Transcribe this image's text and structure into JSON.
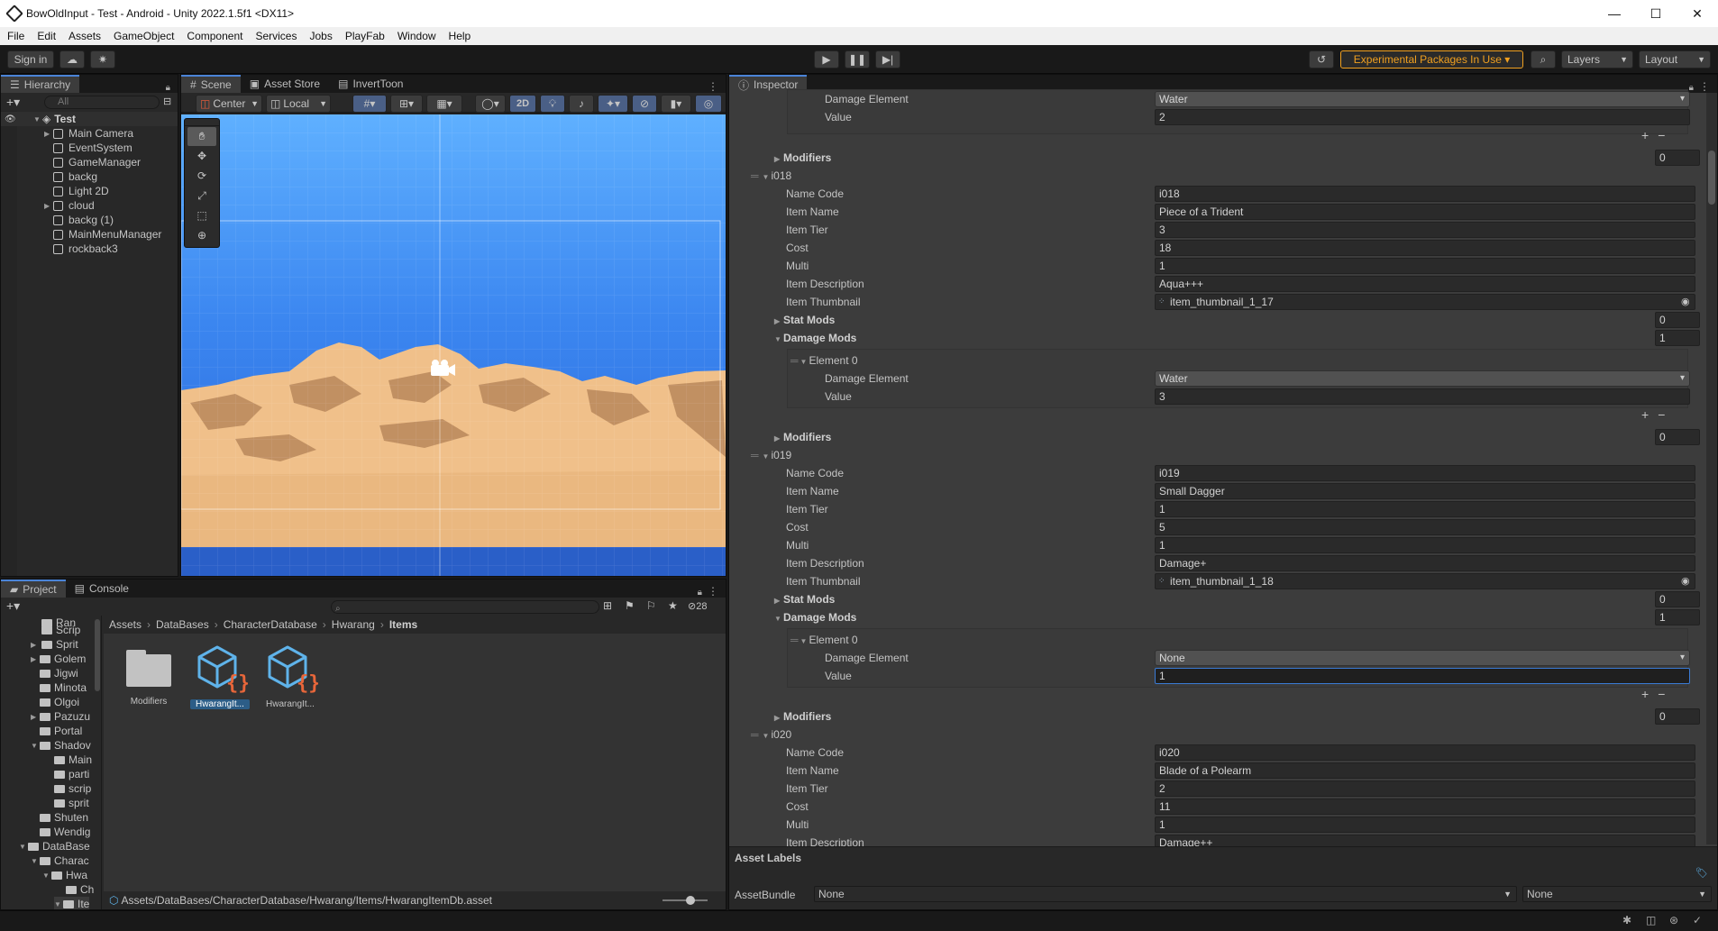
{
  "window": {
    "title": "BowOldInput - Test - Android - Unity 2022.1.5f1 <DX11>",
    "minimize": "—",
    "maximize": "☐",
    "close": "✕"
  },
  "menu": [
    "File",
    "Edit",
    "Assets",
    "GameObject",
    "Component",
    "Services",
    "Jobs",
    "PlayFab",
    "Window",
    "Help"
  ],
  "toolbar": {
    "sign_in": "Sign in",
    "experimental": "Experimental Packages In Use ▾",
    "layers": "Layers",
    "layout": "Layout"
  },
  "hierarchy": {
    "tab": "Hierarchy",
    "search_placeholder": "All",
    "scene": "Test",
    "items": [
      "Main Camera",
      "EventSystem",
      "GameManager",
      "backg",
      "Light 2D",
      "cloud",
      "backg (1)",
      "MainMenuManager",
      "rockback3"
    ]
  },
  "scene_view": {
    "tabs": [
      "Scene",
      "Asset Store",
      "InvertToon"
    ],
    "pivot": "Center",
    "space": "Local",
    "mode2d": "2D"
  },
  "project": {
    "tabs": [
      "Project",
      "Console"
    ],
    "hidden_count": "28",
    "tree": [
      "Ran",
      "Scrip",
      "Sprit",
      "Golem",
      "Jigwi",
      "Minota",
      "Olgoi",
      "Pazuzu",
      "Portal",
      "Shadov",
      "Main",
      "parti",
      "scrip",
      "sprit",
      "Shuten",
      "Wendig",
      "DataBase",
      "Charac",
      "Hwa",
      "Ch",
      "Ite"
    ],
    "breadcrumb": [
      "Assets",
      "DataBases",
      "CharacterDatabase",
      "Hwarang",
      "Items"
    ],
    "assets": [
      {
        "label": "Modifiers",
        "kind": "folder"
      },
      {
        "label": "HwarangIt...",
        "kind": "asset",
        "selected": true
      },
      {
        "label": "HwarangIt...",
        "kind": "asset",
        "selected": false
      }
    ],
    "path": "Assets/DataBases/CharacterDatabase/Hwarang/Items/HwarangItemDb.asset"
  },
  "inspector": {
    "tab": "Inspector",
    "labels": {
      "damage_element": "Damage Element",
      "value": "Value",
      "modifiers": "Modifiers",
      "name_code": "Name Code",
      "item_name": "Item Name",
      "item_tier": "Item Tier",
      "cost": "Cost",
      "multi": "Multi",
      "item_description": "Item Description",
      "item_thumbnail": "Item Thumbnail",
      "stat_mods": "Stat Mods",
      "damage_mods": "Damage Mods",
      "element0": "Element 0"
    },
    "top": {
      "damage_element": "Water",
      "value": "2",
      "modifiers_count": "0"
    },
    "i018": {
      "id": "i018",
      "name_code": "i018",
      "item_name": "Piece of a Trident",
      "item_tier": "3",
      "cost": "18",
      "multi": "1",
      "item_description": "Aqua+++",
      "item_thumbnail": "item_thumbnail_1_17",
      "stat_mods": "0",
      "damage_mods": "1",
      "damage_element": "Water",
      "value": "3",
      "modifiers": "0"
    },
    "i019": {
      "id": "i019",
      "name_code": "i019",
      "item_name": "Small Dagger",
      "item_tier": "1",
      "cost": "5",
      "multi": "1",
      "item_description": "Damage+",
      "item_thumbnail": "item_thumbnail_1_18",
      "stat_mods": "0",
      "damage_mods": "1",
      "damage_element": "None",
      "value": "1",
      "modifiers": "0"
    },
    "i020": {
      "id": "i020",
      "name_code": "i020",
      "item_name": "Blade of a Polearm",
      "item_tier": "2",
      "cost": "11",
      "multi": "1",
      "item_description": "Damage++"
    },
    "asset_labels": "Asset Labels",
    "asset_bundle": "AssetBundle",
    "bundle_value": "None",
    "bundle_variant": "None"
  },
  "colors": {
    "accent": "#4a84d8",
    "experimental": "#f0a020",
    "sky_top": "#5fb0ff",
    "sky_bottom": "#2a66d8",
    "sand": "#f0c08a"
  }
}
